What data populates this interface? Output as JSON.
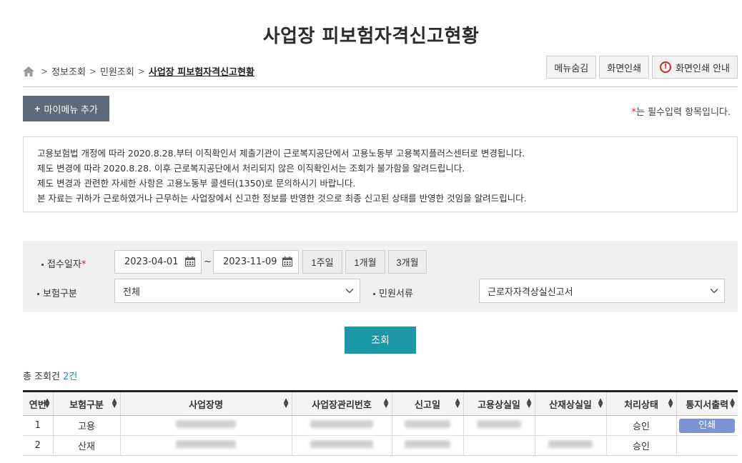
{
  "page": {
    "title": "사업장 피보험자격신고현황"
  },
  "breadcrumb": {
    "items": [
      "정보조회",
      "민원조회"
    ],
    "current": "사업장 피보험자격신고현황"
  },
  "toolbar": {
    "menu_hide": "메뉴숨김",
    "print": "화면인쇄",
    "print_guide": "화면인쇄 안내"
  },
  "mymenu": {
    "label": "마이메뉴 추가"
  },
  "required_note": {
    "star": "*",
    "text": "는 필수입력 항목입니다."
  },
  "notice": {
    "lines": [
      "고용보험법 개정에 따라 2020.8.28.부터 이직확인서 제출기관이 근로복지공단에서 고용노동부 고용복지플러스센터로 변경됩니다.",
      "제도 변경에 따라 2020.8.28. 이후 근로복지공단에서 처리되지 않은 이직확인서는 조회가 불가함을 알려드립니다.",
      "제도 변경과 관련한 자세한 사항은 고용노동부 콜센터(1350)로 문의하시기 바랍니다.",
      "본 자료는 귀하가 근로하였거나 근무하는 사업장에서 신고한 정보를 반영한 것으로 최종 신고된 상태를 반영한 것임을 알려드립니다."
    ]
  },
  "search": {
    "receipt_date_label": "접수일자",
    "required_star": "*",
    "date_from": "2023-04-01",
    "date_to": "2023-11-09",
    "tilde": "~",
    "period_1w": "1주일",
    "period_1m": "1개월",
    "period_3m": "3개월",
    "insurance_type_label": "보험구분",
    "insurance_type_value": "전체",
    "doc_type_label": "민원서류",
    "doc_type_value": "근로자자격상실신고서",
    "submit": "조회"
  },
  "results": {
    "total_label": "총 조회건",
    "total_count": "2건",
    "columns": [
      "연번",
      "보험구분",
      "사업장명",
      "사업장관리번호",
      "신고일",
      "고용상실일",
      "산재상실일",
      "처리상태",
      "통지서출력"
    ],
    "rows": [
      {
        "no": "1",
        "type": "고용",
        "status": "승인",
        "print": "인쇄"
      },
      {
        "no": "2",
        "type": "산재",
        "status": "승인",
        "print": ""
      }
    ]
  },
  "colors": {
    "accent": "#1c97a5",
    "mymenu_bg": "#5d6a77",
    "print_btn": "#7c94d6",
    "required": "#d8232a"
  }
}
